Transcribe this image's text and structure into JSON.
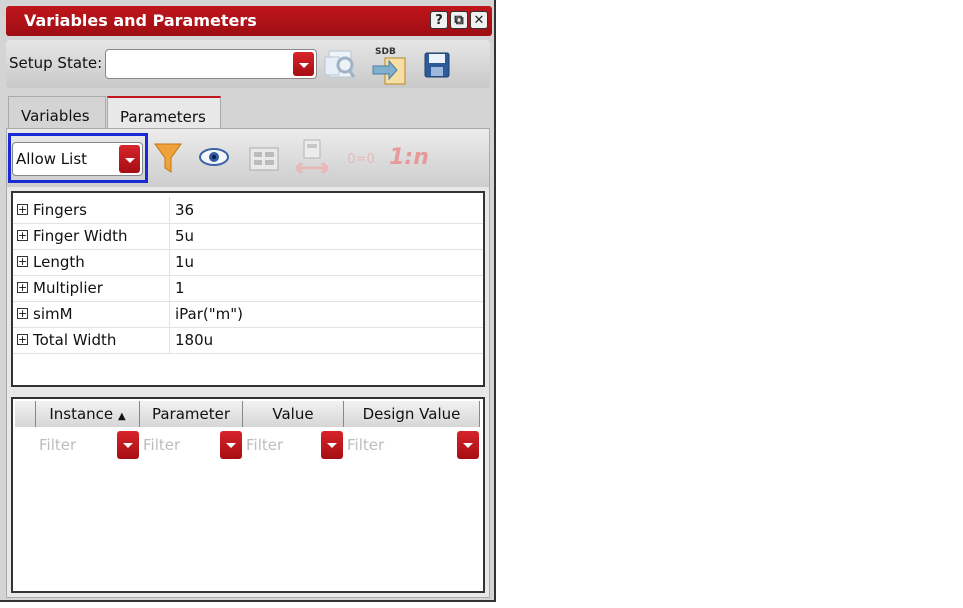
{
  "window": {
    "title": "Variables and Parameters",
    "title_buttons": [
      "?",
      "⧉",
      "✕"
    ]
  },
  "setup": {
    "label": "Setup State:",
    "value": ""
  },
  "tabs": [
    {
      "label": "Variables"
    },
    {
      "label": "Parameters",
      "active": true
    }
  ],
  "toolbar": {
    "filter_mode": "Allow List",
    "one_to_n": "1:n",
    "equals_icon": "0=0"
  },
  "params": [
    {
      "name": "Fingers",
      "value": "36"
    },
    {
      "name": "Finger Width",
      "value": "5u"
    },
    {
      "name": "Length",
      "value": "1u"
    },
    {
      "name": "Multiplier",
      "value": "1"
    },
    {
      "name": "simM",
      "value": "iPar(\"m\")"
    },
    {
      "name": "Total Width",
      "value": "180u"
    }
  ],
  "instances_table": {
    "columns": [
      "Instance",
      "Parameter",
      "Value",
      "Design Value"
    ],
    "sort_indicator": "▲",
    "filter_placeholder": "Filter"
  },
  "colors": {
    "accent": "#c0161d",
    "highlight": "#1a2bd6"
  }
}
